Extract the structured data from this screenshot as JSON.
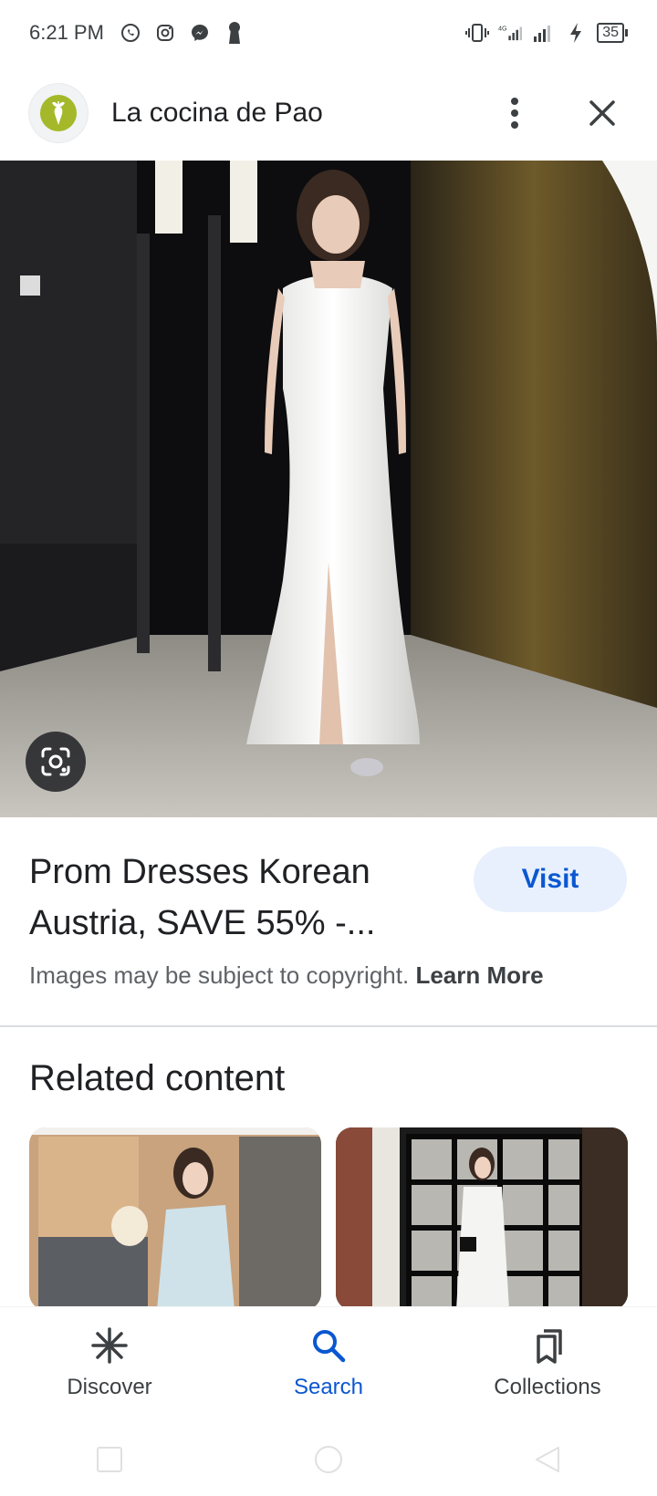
{
  "status_bar": {
    "time": "6:21 PM",
    "battery_level": "35",
    "network": "4G"
  },
  "header": {
    "site_name": "La cocina de Pao"
  },
  "result": {
    "title": "Prom Dresses Korean Austria, SAVE 55% -...",
    "visit_label": "Visit",
    "copyright_text": "Images may be subject to copyright.",
    "learn_more_label": "Learn More"
  },
  "related": {
    "heading": "Related content"
  },
  "bottom_nav": {
    "items": [
      {
        "label": "Discover",
        "icon": "asterisk-icon",
        "active": false
      },
      {
        "label": "Search",
        "icon": "search-icon",
        "active": true
      },
      {
        "label": "Collections",
        "icon": "bookmarks-icon",
        "active": false
      }
    ]
  },
  "colors": {
    "accent": "#0b57d0",
    "visit_bg": "#e8f0fe",
    "text_primary": "#202124",
    "text_secondary": "#5f6368"
  }
}
